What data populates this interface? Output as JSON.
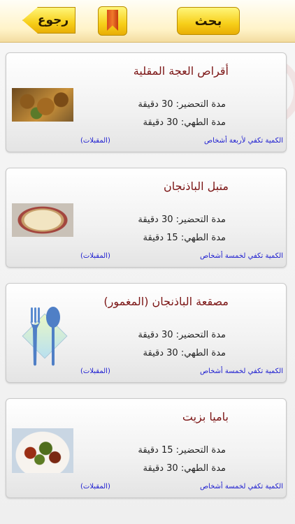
{
  "topbar": {
    "back_label": "رجوع",
    "search_label": "بحث",
    "bookmark_icon": "bookmark-icon"
  },
  "recipes": [
    {
      "title": "أقراص العجة المقلية",
      "prep": "مدة التحضير: 30 دقيقة",
      "cook": "مدة الطهي: 30 دقيقة",
      "serves": "الكمية تكفي لأربعة أشخاص",
      "category": "(المقبلات)",
      "thumb": "fried-omelette-patties-image"
    },
    {
      "title": "متبل الباذنجان",
      "prep": "مدة التحضير: 30 دقيقة",
      "cook": "مدة الطهي: 15 دقيقة",
      "serves": "الكمية تكفي لخمسة أشخاص",
      "category": "(المقبلات)",
      "thumb": "eggplant-mutabal-image"
    },
    {
      "title": "مصقعة الباذنجان (المغمور)",
      "prep": "مدة التحضير: 30 دقيقة",
      "cook": "مدة الطهي: 30 دقيقة",
      "serves": "الكمية تكفي لخمسة أشخاص",
      "category": "(المقبلات)",
      "thumb": "fork-spoon-placeholder-icon"
    },
    {
      "title": "باميا بزيت",
      "prep": "مدة التحضير: 15 دقيقة",
      "cook": "مدة الطهي: 30 دقيقة",
      "serves": "الكمية تكفي لخمسة أشخاص",
      "category": "(المقبلات)",
      "thumb": "okra-in-oil-image"
    }
  ],
  "colors": {
    "title": "#7b1414",
    "link": "#1b1bd0",
    "button": "#f7cf1a"
  }
}
